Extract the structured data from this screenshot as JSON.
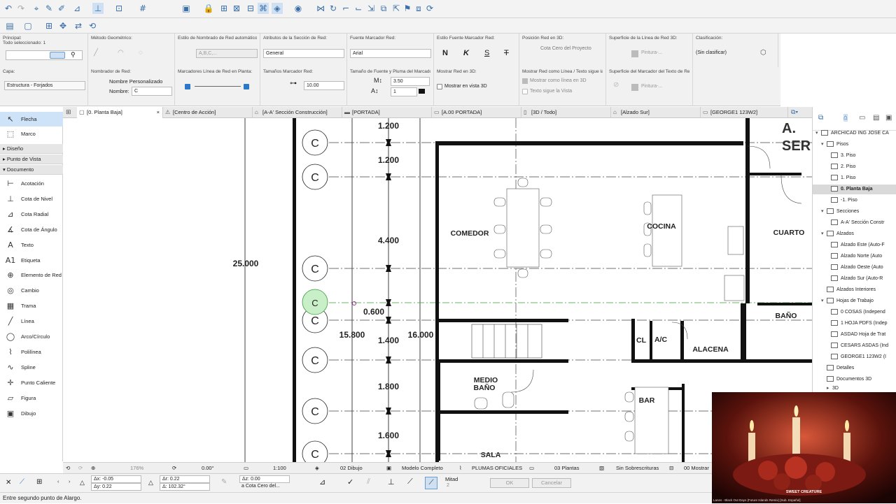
{
  "infobox": {
    "principal_label": "Principal:",
    "selected_label": "Todo seleccionado: 1",
    "metodo_label": "Método Geométrico:",
    "estilo_nombrado_label": "Estilo de Nombrado de Red automático:",
    "estilo_nombrado_value": "A,B,C,...",
    "atributos_label": "Atributos de la Sección de Red:",
    "atributos_value": "General",
    "fuente_label": "Fuente Marcador Red:",
    "fuente_value": "Arial",
    "estilo_fuente_label": "Estilo Fuente Marcador Red:",
    "bold_label": "N",
    "italic_label": "K",
    "strike_label": "S",
    "t_label": "T",
    "posicion_label": "Posición Red en 3D:",
    "posicion_value": "Cota Cero del Proyecto",
    "superficie_label": "Superficie de la Línea de Red 3D:",
    "superficie_value": "Pintura-...",
    "clasificacion_label": "Clasificación:",
    "clasificacion_value": "(Sin clasificar)",
    "capa_label": "Capa:",
    "capa_value": "Estructura - Forjados",
    "nombrador_label": "Nombrador de Red:",
    "nombre_personalizado": "Nombre Personalizado",
    "nombre_label": "Nombre:",
    "nombre_value": "C",
    "marcadores_label": "Marcadores Línea de Red en Planta:",
    "tamanos_label": "Tamaños Marcador Red:",
    "tamanos_value": "10.00",
    "tamano_fuente_label": "Tamaño de Fuente y Pluma del Marcador d...",
    "tamano_fuente_value": "3.50",
    "pluma_value": "1",
    "mostrar_3d_label": "Mostrar Red en 3D:",
    "mostrar_vista_3d": "Mostrar en vista 3D",
    "mostrar_linea_label": "Mostrar Red como Línea / Texto sigue la ...",
    "mostrar_linea_3d": "Mostrar como línea en 3D",
    "texto_sigue": "Texto sigue la Vista",
    "superficie_texto_label": "Superficie del Marcador del Texto de Red 3D:",
    "superficie_texto_value": "Pintura-..."
  },
  "toolbox": {
    "flecha": "Flecha",
    "marco": "Marco",
    "diseno": "Diseño",
    "punto_vista": "Punto de Vista",
    "documento": "Documento",
    "tools": [
      "Acotación",
      "Cota de Nivel",
      "Cota Radial",
      "Cota de Ángulo",
      "Texto",
      "Etiqueta",
      "Elemento de Red",
      "Cambio",
      "Trama",
      "Línea",
      "Arco/Círculo",
      "Polilínea",
      "Spline",
      "Punto Caliente",
      "Figura",
      "Dibujo"
    ]
  },
  "tabs": [
    "[0. Planta Baja]",
    "[Centro de Acción]",
    "[A-A' Sección Construcción]",
    "[PORTADA]",
    "[A.00 PORTADA]",
    "[3D / Todo]",
    "[Alzado Sur]",
    "[GEORGE1 123W2]"
  ],
  "drawing": {
    "dims_left": [
      "1.200",
      "1.200",
      "4.400",
      "0.600",
      "1.400",
      "1.800",
      "1.600"
    ],
    "dim_total": "25.000",
    "dim_15": "15.800",
    "dim_16": "16.000",
    "grid_label": "C",
    "rooms": {
      "comedor": "COMEDOR",
      "cocina": "COCINA",
      "cuarto": "CUARTO",
      "bano": "BAÑO",
      "cl": "CL",
      "ac": "A/C",
      "alacena": "ALACENA",
      "medio_bano_1": "MEDIO",
      "medio_bano_2": "BAÑO",
      "bar": "BAR",
      "sala": "SALA"
    },
    "title_a": "A.",
    "title_ser": "SER"
  },
  "navigator": {
    "project": "ARCHICAD ING JOSE CA",
    "pisos": "Pisos",
    "floors": [
      "3. Piso",
      "2. Piso",
      "1. Piso",
      "0. Planta Baja",
      "-1. Piso"
    ],
    "secciones": "Secciones",
    "seccion_item": "A-A' Sección Constr",
    "alzados": "Alzados",
    "alzados_items": [
      "Alzado Este (Auto-F",
      "Alzado Norte (Auto",
      "Alzado Oeste (Auto",
      "Alzado Sur (Auto-R"
    ],
    "alzados_interiores": "Alzados Interiores",
    "hojas": "Hojas de Trabajo",
    "hojas_items": [
      "0 COSAS (Independ",
      "1 HOJA PDFS (Indep",
      "ASDAD Hoja de Trat",
      "CESARS ASDAS (Ind",
      "GEORGE1 123W2 (I"
    ],
    "detalles": "Detalles",
    "documentos_3d": "Documentos 3D",
    "item_3d": "3D"
  },
  "statusbar": {
    "zoom": "176%",
    "angle": "0.00°",
    "scale": "1:100",
    "layer_combo": "02 Dibujo",
    "model": "Modelo Completo",
    "plumas": "PLUMAS OFICIALES",
    "plantas": "03 Plantas",
    "sobreescrituras": "Sin Sobrescrituras",
    "mostrar": "00 Mostrar"
  },
  "coords": {
    "dx": "Δx: -0.05",
    "dy": "Δy: 0.22",
    "dr": "Δr: 0.22",
    "da": "Δ: 102.32°",
    "dz": "Δz: 0.00",
    "cota": "a Cota Cero del...",
    "mitad": "Mitad",
    "mitad_n": "2",
    "ok": "OK",
    "cancel": "Cancelar"
  },
  "hint": "Entre segundo punto de Alargo.",
  "video": {
    "caption": "SWEET CREATURE",
    "subcaption": "Lanes - Black Out Days (Future Islands Remix) [Sub. Español]"
  }
}
